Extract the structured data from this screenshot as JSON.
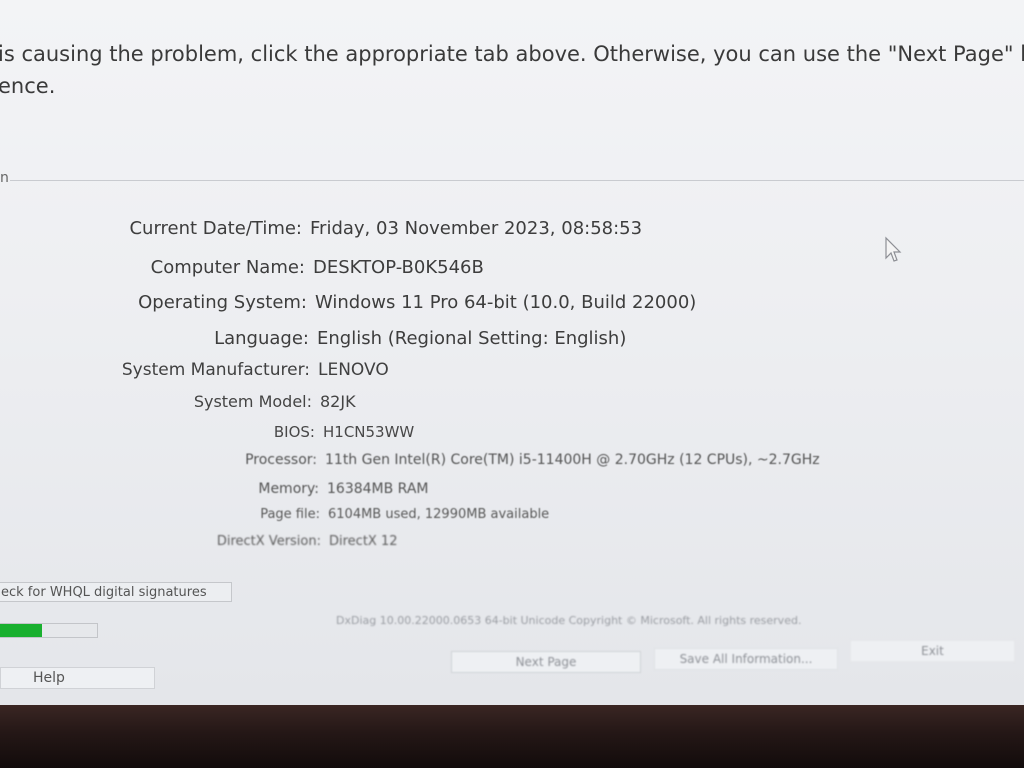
{
  "intro": {
    "line1": "is causing the problem, click the appropriate tab above.  Otherwise, you can use the \"Next Page\" button below",
    "line2": "ence."
  },
  "group_fragment": "n",
  "system_info": [
    {
      "label": "Current Date/Time:",
      "value": "Friday, 03 November 2023, 08:58:53"
    },
    {
      "label": "Computer Name:",
      "value": "DESKTOP-B0K546B"
    },
    {
      "label": "Operating System:",
      "value": "Windows 11 Pro 64-bit (10.0, Build 22000)"
    },
    {
      "label": "Language:",
      "value": "English (Regional Setting: English)"
    },
    {
      "label": "System Manufacturer:",
      "value": "LENOVO"
    },
    {
      "label": "System Model:",
      "value": "82JK"
    },
    {
      "label": "BIOS:",
      "value": "H1CN53WW"
    },
    {
      "label": "Processor:",
      "value": "11th Gen Intel(R) Core(TM) i5-11400H @ 2.70GHz (12 CPUs), ~2.7GHz"
    },
    {
      "label": "Memory:",
      "value": "16384MB RAM"
    },
    {
      "label": "Page file:",
      "value": "6104MB used, 12990MB available"
    },
    {
      "label": "DirectX Version:",
      "value": "DirectX 12"
    }
  ],
  "whql_checkbox_label": "eck for WHQL digital signatures",
  "progress": {
    "fraction": 0.44,
    "color": "#19b02f"
  },
  "copyright": "DxDiag 10.00.22000.0653 64-bit Unicode  Copyright © Microsoft. All rights reserved.",
  "buttons": {
    "help": "Help",
    "next_page": "Next Page",
    "save_all": "Save All Information...",
    "exit": "Exit"
  }
}
